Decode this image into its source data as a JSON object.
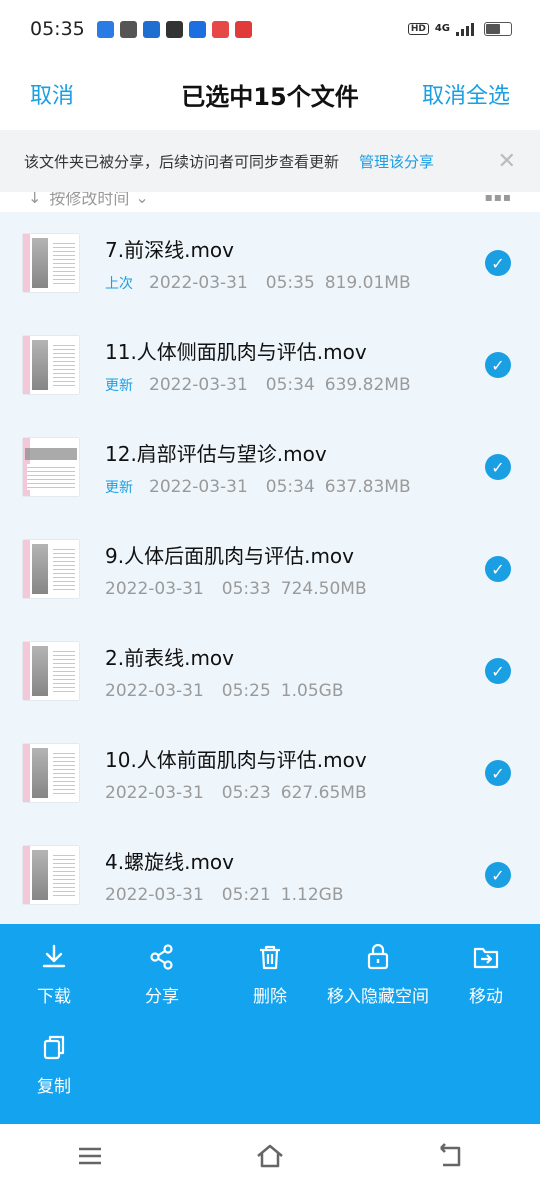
{
  "status_bar": {
    "time": "05:35",
    "badge": "HD",
    "network": "4G",
    "app_icons": [
      {
        "name": "cloud-app-icon",
        "color": "#2a7be4"
      },
      {
        "name": "wechat-app-icon",
        "color": "#555555"
      },
      {
        "name": "shield-app-icon",
        "color": "#1f6fd1"
      },
      {
        "name": "mail-app-icon",
        "color": "#333333"
      },
      {
        "name": "translate-app-icon",
        "color": "#1b6fe0"
      },
      {
        "name": "red-app-icon",
        "color": "#e64848"
      },
      {
        "name": "red-app-2-icon",
        "color": "#e03a3a"
      }
    ]
  },
  "header": {
    "cancel": "取消",
    "title": "已选中15个文件",
    "deselect_all": "取消全选"
  },
  "notice": {
    "text": "该文件夹已被分享，后续访问者可同步查看更新",
    "link": "管理该分享",
    "close": "✕"
  },
  "sort": {
    "label": "按修改时间",
    "arrow": "↓",
    "caret": "⌄",
    "grid": "▪▪▪"
  },
  "files": [
    {
      "name": "7.前深线.mov",
      "tag": "上次",
      "date": "2022-03-31",
      "time": "05:35",
      "size": "819.01MB",
      "selected": true,
      "thumb": "page"
    },
    {
      "name": "11.人体侧面肌肉与评估.mov",
      "tag": "更新",
      "date": "2022-03-31",
      "time": "05:34",
      "size": "639.82MB",
      "selected": true,
      "thumb": "page"
    },
    {
      "name": "12.肩部评估与望诊.mov",
      "tag": "更新",
      "date": "2022-03-31",
      "time": "05:34",
      "size": "637.83MB",
      "selected": true,
      "thumb": "wide"
    },
    {
      "name": "9.人体后面肌肉与评估.mov",
      "tag": "",
      "date": "2022-03-31",
      "time": "05:33",
      "size": "724.50MB",
      "selected": true,
      "thumb": "page"
    },
    {
      "name": "2.前表线.mov",
      "tag": "",
      "date": "2022-03-31",
      "time": "05:25",
      "size": "1.05GB",
      "selected": true,
      "thumb": "page"
    },
    {
      "name": "10.人体前面肌肉与评估.mov",
      "tag": "",
      "date": "2022-03-31",
      "time": "05:23",
      "size": "627.65MB",
      "selected": true,
      "thumb": "page"
    },
    {
      "name": "4.螺旋线.mov",
      "tag": "",
      "date": "2022-03-31",
      "time": "05:21",
      "size": "1.12GB",
      "selected": true,
      "thumb": "page"
    }
  ],
  "toolbar": [
    {
      "id": "download",
      "label": "下载",
      "icon": "download-icon"
    },
    {
      "id": "share",
      "label": "分享",
      "icon": "share-icon"
    },
    {
      "id": "delete",
      "label": "删除",
      "icon": "trash-icon"
    },
    {
      "id": "hide",
      "label": "移入隐藏空间",
      "icon": "lock-icon"
    },
    {
      "id": "move",
      "label": "移动",
      "icon": "folder-move-icon"
    },
    {
      "id": "copy",
      "label": "复制",
      "icon": "copy-icon"
    }
  ],
  "colors": {
    "accent": "#1a9fe3",
    "toolbar_bg": "#13a3ef",
    "list_bg": "#eef6fc"
  }
}
